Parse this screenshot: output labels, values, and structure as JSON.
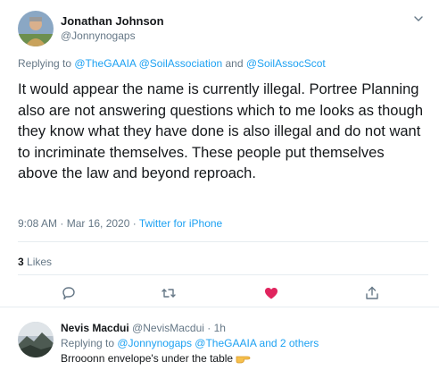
{
  "tweet": {
    "author_name": "Jonathan Johnson",
    "author_handle": "@Jonnynogaps",
    "replying_prefix": "Replying to ",
    "replying_to": [
      "@TheGAAIA",
      "@SoilAssociation",
      "@SoilAssocScot"
    ],
    "replying_sep_1": " ",
    "replying_sep_2": " and ",
    "text": "It would appear the name is currently illegal. Portree Planning also are not answering questions which to me looks as though they know what they have done is also illegal and do not want to incriminate themselves. These people put themselves above the law and beyond reproach.",
    "timestamp": "9:08 AM · Mar 16, 2020 · ",
    "source": "Twitter for iPhone",
    "likes_count": "3",
    "likes_label": " Likes",
    "actions": [
      "comment-icon",
      "retweet-icon",
      "heart-icon",
      "share-icon"
    ],
    "liked_color": "#e0245e"
  },
  "reply": {
    "author_name": "Nevis Macdui",
    "author_handle": "@NevisMacdui",
    "time_sep": " · ",
    "time": "1h",
    "replying_prefix": "Replying to ",
    "replying_to_1": "@Jonnynogaps",
    "replying_to_2": "@TheGAAIA",
    "replying_suffix": " and 2 others",
    "text": "Brrooonn envelope's under the table",
    "emoji": "pointing-hand-icon"
  },
  "colors": {
    "link": "#1da1f2",
    "muted": "#657786",
    "text": "#14171a"
  }
}
